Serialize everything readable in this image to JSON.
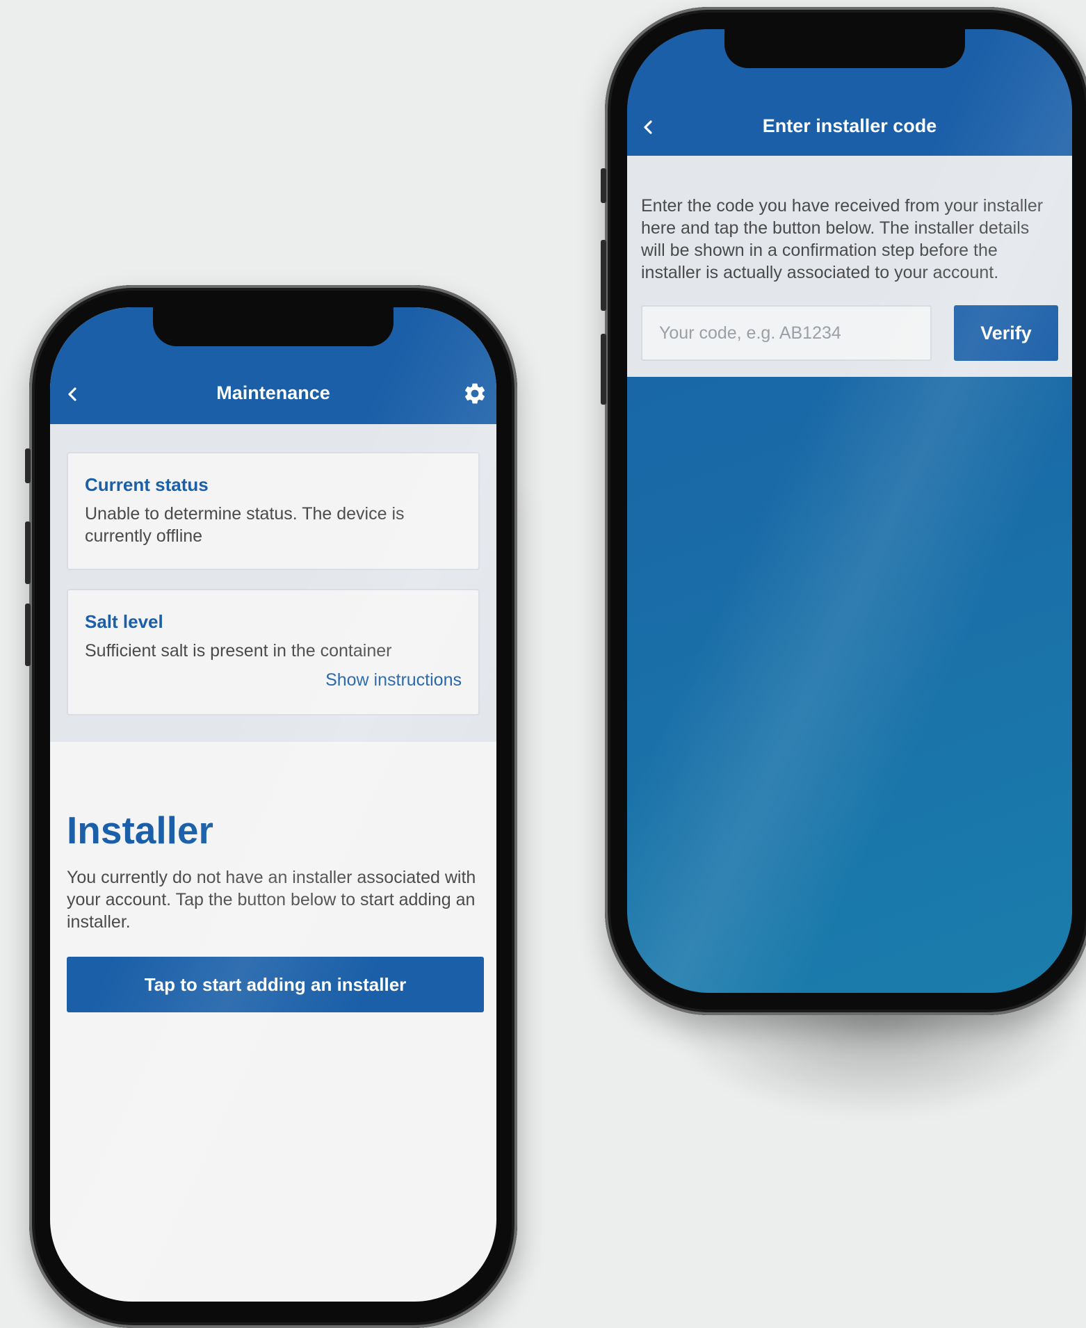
{
  "colors": {
    "brand_blue": "#1a5fa8",
    "body_text": "#4a4a4a",
    "status_bg": "#e3e7ec",
    "page_bg": "#eceeee"
  },
  "maintenance_screen": {
    "header": {
      "back_icon": "chevron-left-icon",
      "title": "Maintenance",
      "settings_icon": "gear-icon"
    },
    "status_cards": [
      {
        "title": "Current status",
        "text": "Unable to determine status. The device is currently offline"
      },
      {
        "title": "Salt level",
        "text": "Sufficient salt is present in the container",
        "link": "Show instructions"
      }
    ],
    "installer": {
      "heading": "Installer",
      "text": "You currently do not have an installer associated with your account. Tap the button below to start adding an installer.",
      "button_label": "Tap to start adding an installer"
    }
  },
  "installer_code_screen": {
    "header": {
      "back_icon": "chevron-left-icon",
      "title": "Enter installer code"
    },
    "instructions": "Enter the code you have received from your installer here and tap the button below. The installer details will be shown in a confirmation step before the installer is actually associated to your account.",
    "code_input": {
      "placeholder": "Your code, e.g. AB1234",
      "value": ""
    },
    "verify_label": "Verify"
  }
}
